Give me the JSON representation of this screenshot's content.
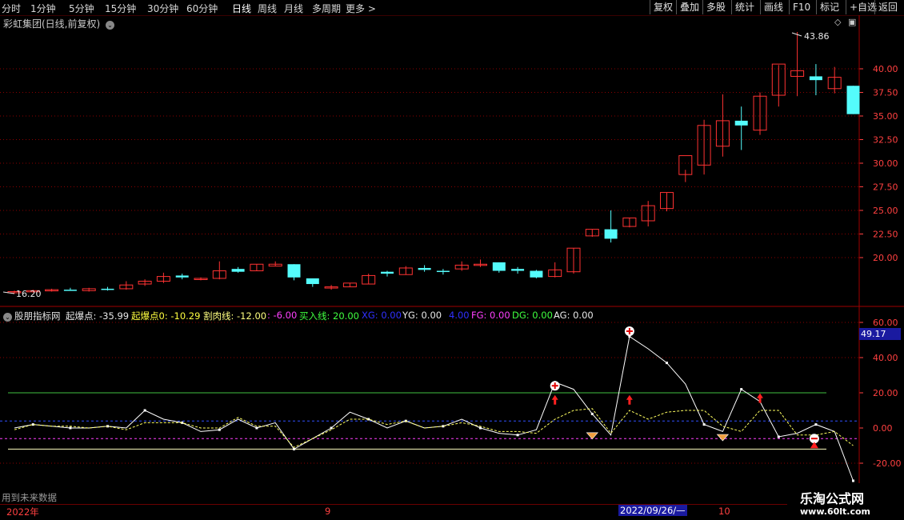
{
  "toolbar": {
    "periods": [
      "分时",
      "1分钟",
      "5分钟",
      "15分钟",
      "30分钟",
      "60分钟",
      "日线",
      "周线",
      "月线",
      "多周期",
      "更多 >"
    ],
    "active_period": "日线",
    "buttons": [
      "复权",
      "叠加",
      "多股",
      "统计",
      "画线",
      "F10",
      "标记",
      "+自选",
      "返回"
    ]
  },
  "price_panel": {
    "title": "彩虹集团(日线,前复权)",
    "high_label": "43.86",
    "low_label": "16.20",
    "y_ticks": [
      "40.00",
      "37.50",
      "35.00",
      "32.50",
      "30.00",
      "27.50",
      "25.00",
      "22.50",
      "20.00"
    ]
  },
  "indicator_panel": {
    "name": "股朋指标网",
    "labels": [
      {
        "text": "起爆点: -35.99",
        "color": "#e8e8e8"
      },
      {
        "text": "起爆点0: -10.29",
        "color": "#ffff40"
      },
      {
        "text": "割肉线: -12.00",
        "color": "#ffff80"
      },
      {
        "text": ": -6.00",
        "color": "#ff40ff"
      },
      {
        "text": "买入线: 20.00",
        "color": "#40ff40"
      },
      {
        "text": "XG: 0.00",
        "color": "#3030ff"
      },
      {
        "text": "YG: 0.00",
        "color": "#e8e8e8"
      },
      {
        "text": "4.00",
        "color": "#3030ff"
      },
      {
        "text": "FG: 0.00",
        "color": "#ff40ff"
      },
      {
        "text": "DG: 0.00",
        "color": "#40ff40"
      },
      {
        "text": "AG: 0.00",
        "color": "#e8e8e8"
      }
    ],
    "y_ticks": [
      "60.00",
      "40.00",
      "20.00",
      "0.00",
      "-20.00"
    ],
    "last_value": "49.17",
    "future_note": "用到未来数据"
  },
  "date_axis": {
    "labels": [
      "2022年",
      "9",
      "10"
    ],
    "cursor_date": "2022/09/26/—"
  },
  "watermark": {
    "title": "乐淘公式网",
    "url": "www.60lt.com"
  },
  "colors": {
    "up": "#ff3232",
    "down": "#54fcfc",
    "grid": "#8b0000",
    "buy_line": "#40c040",
    "cut_line": "#ffffc0"
  },
  "chart_data": [
    {
      "type": "candlestick",
      "title": "彩虹集团(日线,前复权)",
      "ylim": [
        16,
        44
      ],
      "candles": [
        {
          "o": 16.3,
          "h": 16.5,
          "l": 16.2,
          "c": 16.4,
          "up": true
        },
        {
          "o": 16.4,
          "h": 16.6,
          "l": 16.3,
          "c": 16.5,
          "up": true
        },
        {
          "o": 16.5,
          "h": 16.7,
          "l": 16.4,
          "c": 16.6,
          "up": true
        },
        {
          "o": 16.6,
          "h": 16.8,
          "l": 16.5,
          "c": 16.5,
          "up": false
        },
        {
          "o": 16.5,
          "h": 16.8,
          "l": 16.4,
          "c": 16.7,
          "up": true
        },
        {
          "o": 16.7,
          "h": 16.9,
          "l": 16.5,
          "c": 16.6,
          "up": false
        },
        {
          "o": 16.7,
          "h": 17.5,
          "l": 16.6,
          "c": 17.1,
          "up": true
        },
        {
          "o": 17.2,
          "h": 17.7,
          "l": 17.0,
          "c": 17.5,
          "up": true
        },
        {
          "o": 17.5,
          "h": 18.4,
          "l": 17.3,
          "c": 18.0,
          "up": true
        },
        {
          "o": 18.1,
          "h": 18.3,
          "l": 17.7,
          "c": 17.9,
          "up": false
        },
        {
          "o": 17.7,
          "h": 17.9,
          "l": 17.6,
          "c": 17.8,
          "up": true
        },
        {
          "o": 17.8,
          "h": 19.6,
          "l": 17.7,
          "c": 18.6,
          "up": true
        },
        {
          "o": 18.8,
          "h": 19.0,
          "l": 18.4,
          "c": 18.5,
          "up": false
        },
        {
          "o": 18.6,
          "h": 19.3,
          "l": 18.6,
          "c": 19.3,
          "up": true
        },
        {
          "o": 19.1,
          "h": 19.6,
          "l": 19.1,
          "c": 19.3,
          "up": true
        },
        {
          "o": 19.3,
          "h": 19.3,
          "l": 17.6,
          "c": 17.9,
          "up": false
        },
        {
          "o": 17.8,
          "h": 17.8,
          "l": 16.9,
          "c": 17.2,
          "up": false
        },
        {
          "o": 16.9,
          "h": 17.1,
          "l": 16.6,
          "c": 16.9,
          "up": true
        },
        {
          "o": 16.9,
          "h": 17.3,
          "l": 16.9,
          "c": 17.3,
          "up": true
        },
        {
          "o": 17.2,
          "h": 18.3,
          "l": 17.2,
          "c": 18.1,
          "up": true
        },
        {
          "o": 18.5,
          "h": 18.6,
          "l": 18.0,
          "c": 18.3,
          "up": false
        },
        {
          "o": 18.2,
          "h": 19.1,
          "l": 18.2,
          "c": 18.9,
          "up": true
        },
        {
          "o": 18.9,
          "h": 19.2,
          "l": 18.5,
          "c": 18.7,
          "up": false
        },
        {
          "o": 18.6,
          "h": 18.8,
          "l": 18.2,
          "c": 18.5,
          "up": false
        },
        {
          "o": 18.8,
          "h": 19.6,
          "l": 18.6,
          "c": 19.2,
          "up": true
        },
        {
          "o": 19.3,
          "h": 19.8,
          "l": 19.0,
          "c": 19.2,
          "up": true
        },
        {
          "o": 19.5,
          "h": 19.5,
          "l": 18.4,
          "c": 18.6,
          "up": false
        },
        {
          "o": 18.8,
          "h": 19.0,
          "l": 18.3,
          "c": 18.6,
          "up": false
        },
        {
          "o": 18.6,
          "h": 18.7,
          "l": 17.8,
          "c": 17.9,
          "up": false
        },
        {
          "o": 18.0,
          "h": 19.5,
          "l": 17.9,
          "c": 18.7,
          "up": true
        },
        {
          "o": 18.5,
          "h": 21.0,
          "l": 18.3,
          "c": 21.0,
          "up": true
        },
        {
          "o": 22.3,
          "h": 23.0,
          "l": 22.2,
          "c": 23.0,
          "up": true
        },
        {
          "o": 23.0,
          "h": 25.0,
          "l": 21.6,
          "c": 22.0,
          "up": false
        },
        {
          "o": 23.3,
          "h": 24.2,
          "l": 23.2,
          "c": 24.2,
          "up": true
        },
        {
          "o": 23.9,
          "h": 26.0,
          "l": 23.3,
          "c": 25.5,
          "up": true
        },
        {
          "o": 25.2,
          "h": 26.9,
          "l": 24.9,
          "c": 26.9,
          "up": true
        },
        {
          "o": 28.8,
          "h": 29.3,
          "l": 28.0,
          "c": 30.8,
          "up": true
        },
        {
          "o": 29.8,
          "h": 34.6,
          "l": 28.8,
          "c": 34.0,
          "up": true
        },
        {
          "o": 31.8,
          "h": 37.3,
          "l": 30.7,
          "c": 34.5,
          "up": true
        },
        {
          "o": 34.5,
          "h": 36.0,
          "l": 31.4,
          "c": 34.0,
          "up": false
        },
        {
          "o": 33.5,
          "h": 37.5,
          "l": 33.0,
          "c": 37.1,
          "up": true
        },
        {
          "o": 37.2,
          "h": 40.4,
          "l": 36.0,
          "c": 40.5,
          "up": true
        },
        {
          "o": 39.2,
          "h": 43.9,
          "l": 37.1,
          "c": 39.8,
          "up": true
        },
        {
          "o": 39.2,
          "h": 40.5,
          "l": 37.2,
          "c": 38.8,
          "up": false
        },
        {
          "o": 37.9,
          "h": 40.2,
          "l": 37.4,
          "c": 39.1,
          "up": true
        },
        {
          "o": 38.2,
          "h": 38.2,
          "l": 35.2,
          "c": 35.2,
          "up": false
        }
      ]
    },
    {
      "type": "line",
      "title": "股朋指标网",
      "ylim": [
        -26,
        66
      ],
      "hlines": [
        {
          "name": "买入线",
          "y": 20,
          "color": "#40c040"
        },
        {
          "name": "割肉线",
          "y": -12,
          "color": "#ffffc0"
        },
        {
          "name": "",
          "y": -6,
          "color": "#ff40ff"
        },
        {
          "name": "",
          "y": 4,
          "color": "#3050ff"
        }
      ],
      "series": [
        {
          "name": "起爆点",
          "color": "#ffffff",
          "values": [
            0,
            2,
            1,
            0,
            0,
            1,
            0,
            10,
            5,
            3,
            -2,
            -1,
            5,
            0,
            3,
            -12,
            -6,
            0,
            9,
            5,
            0,
            4,
            0,
            1,
            5,
            0,
            -3,
            -4,
            -1,
            26,
            22,
            8,
            -4,
            52,
            45,
            37,
            25,
            2,
            -2,
            22,
            15,
            -5,
            -3,
            2,
            -2,
            -30
          ]
        },
        {
          "name": "起爆点0",
          "color": "#ffff60",
          "dashed": true,
          "values": [
            -1,
            2,
            1,
            1,
            0,
            1,
            -1,
            3,
            3,
            3,
            0,
            0,
            6,
            1,
            1,
            -11,
            -6,
            -1,
            5,
            5,
            2,
            4,
            0,
            1,
            3,
            1,
            -2,
            -2,
            -3,
            5,
            10,
            11,
            -3,
            10,
            5,
            9,
            10,
            10,
            1,
            -2,
            10,
            10,
            -4,
            -4,
            -2,
            -10
          ]
        }
      ]
    }
  ]
}
